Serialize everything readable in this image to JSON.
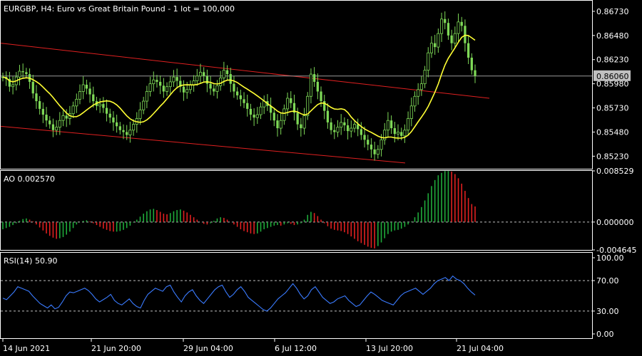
{
  "window": {
    "title": "EURGBP, H4:  Euro vs Great Britain Pound - 1 lot = 100,000"
  },
  "chart_data": [
    {
      "type": "candlestick",
      "symbol": "EURGBP",
      "timeframe": "H4",
      "title": "EURGBP, H4:  Euro vs Great Britain Pound - 1 lot = 100,000",
      "ylim": [
        0.851,
        0.8684
      ],
      "y_ticks": [
        "0.86730",
        "0.86480",
        "0.86230",
        "0.85980",
        "0.85730",
        "0.85480",
        "0.85230"
      ],
      "y_tick_values": [
        0.8673,
        0.8648,
        0.8623,
        0.8598,
        0.8573,
        0.8548,
        0.8523
      ],
      "current_price": "0.86060",
      "current_price_value": 0.8606,
      "x_ticks": [
        "14 Jun 2021",
        "21 Jun 20:00",
        "29 Jun 04:00",
        "6 Jul 12:00",
        "13 Jul 20:00",
        "21 Jul 04:00"
      ],
      "close_series": [
        0.8605,
        0.8603,
        0.8595,
        0.8597,
        0.8605,
        0.8611,
        0.861,
        0.8608,
        0.86,
        0.8588,
        0.858,
        0.8572,
        0.8566,
        0.856,
        0.8556,
        0.855,
        0.8553,
        0.856,
        0.8565,
        0.8562,
        0.8567,
        0.8575,
        0.8582,
        0.859,
        0.8597,
        0.8593,
        0.8587,
        0.858,
        0.8575,
        0.8577,
        0.8573,
        0.8567,
        0.8563,
        0.8558,
        0.8554,
        0.855,
        0.8548,
        0.8545,
        0.855,
        0.8556,
        0.8562,
        0.8571,
        0.858,
        0.859,
        0.8598,
        0.8602,
        0.86,
        0.8596,
        0.859,
        0.8595,
        0.86,
        0.8605,
        0.8601,
        0.8595,
        0.8589,
        0.8592,
        0.8597,
        0.8601,
        0.8606,
        0.861,
        0.8606,
        0.8598,
        0.8593,
        0.859,
        0.8596,
        0.8604,
        0.8612,
        0.8608,
        0.8598,
        0.859,
        0.8586,
        0.8582,
        0.8578,
        0.8572,
        0.8566,
        0.8563,
        0.8566,
        0.8574,
        0.858,
        0.8575,
        0.8568,
        0.856,
        0.8552,
        0.856,
        0.8572,
        0.8583,
        0.8578,
        0.8568,
        0.8556,
        0.8552,
        0.8565,
        0.8585,
        0.8608,
        0.86,
        0.859,
        0.858,
        0.857,
        0.8558,
        0.855,
        0.8548,
        0.8553,
        0.8558,
        0.8555,
        0.8549,
        0.8552,
        0.8556,
        0.8551,
        0.8545,
        0.854,
        0.8535,
        0.853,
        0.8525,
        0.853,
        0.854,
        0.855,
        0.856,
        0.8552,
        0.8546,
        0.8548,
        0.8544,
        0.855,
        0.8562,
        0.8575,
        0.8585,
        0.8592,
        0.8598,
        0.8612,
        0.863,
        0.864,
        0.8636,
        0.865,
        0.8665,
        0.8661,
        0.8648,
        0.864,
        0.865,
        0.8662,
        0.8658,
        0.864,
        0.8625,
        0.8612,
        0.8606
      ]
    },
    {
      "type": "histogram",
      "indicator": "AO",
      "title": "AO 0.002570",
      "ylim": [
        -0.004645,
        0.008529
      ],
      "y_ticks": [
        "0.008529",
        "0.000000",
        "-0.004645"
      ],
      "y_tick_values": [
        0.008529,
        0.0,
        -0.004645
      ],
      "values": [
        -0.0012,
        -0.001,
        -0.0008,
        -0.0005,
        -0.0002,
        0.0002,
        0.0005,
        0.0006,
        0.0004,
        0.0001,
        -0.0004,
        -0.0009,
        -0.0014,
        -0.0019,
        -0.0023,
        -0.0026,
        -0.0028,
        -0.0027,
        -0.0025,
        -0.0021,
        -0.0016,
        -0.001,
        -0.0004,
        0.0,
        0.0002,
        0.0003,
        0.0001,
        -0.0002,
        -0.0005,
        -0.0008,
        -0.0011,
        -0.0013,
        -0.0015,
        -0.0016,
        -0.0016,
        -0.0015,
        -0.0013,
        -0.001,
        -0.0006,
        -0.0001,
        0.0004,
        0.0009,
        0.0014,
        0.0018,
        0.0021,
        0.0022,
        0.002,
        0.0017,
        0.0014,
        0.0013,
        0.0015,
        0.0018,
        0.002,
        0.0021,
        0.0019,
        0.0016,
        0.0012,
        0.0008,
        0.0004,
        0.0,
        -0.0003,
        -0.0004,
        -0.0002,
        0.0002,
        0.0006,
        0.0008,
        0.0007,
        0.0004,
        0.0,
        -0.0004,
        -0.0008,
        -0.0012,
        -0.0015,
        -0.0017,
        -0.0019,
        -0.002,
        -0.0019,
        -0.0016,
        -0.0012,
        -0.001,
        -0.0008,
        -0.0006,
        -0.0005,
        -0.0006,
        -0.0004,
        -0.0002,
        -0.0003,
        -0.0005,
        -0.0004,
        -0.0002,
        0.0004,
        0.0012,
        0.0017,
        0.0015,
        0.001,
        0.0004,
        -0.0002,
        -0.0007,
        -0.0011,
        -0.0013,
        -0.0014,
        -0.0015,
        -0.0017,
        -0.002,
        -0.0024,
        -0.0028,
        -0.0032,
        -0.0035,
        -0.0038,
        -0.0041,
        -0.0043,
        -0.0044,
        -0.004,
        -0.0034,
        -0.0027,
        -0.002,
        -0.0016,
        -0.0014,
        -0.0013,
        -0.0011,
        -0.0008,
        -0.0004,
        0.0001,
        0.0008,
        0.0016,
        0.0025,
        0.0036,
        0.0048,
        0.006,
        0.007,
        0.0078,
        0.0082,
        0.0085,
        0.0085,
        0.0084,
        0.008,
        0.0073,
        0.0064,
        0.0052,
        0.004,
        0.003,
        0.0026
      ]
    },
    {
      "type": "line",
      "indicator": "RSI(14)",
      "title": "RSI(14) 50.90",
      "ylim": [
        0,
        100
      ],
      "y_ticks": [
        "100.00",
        "70.00",
        "30.00",
        "0.00"
      ],
      "y_tick_values": [
        100,
        70,
        30,
        0
      ],
      "levels": [
        70,
        30
      ],
      "values": [
        47,
        45,
        50,
        55,
        62,
        60,
        58,
        56,
        50,
        45,
        40,
        37,
        34,
        38,
        33,
        35,
        42,
        50,
        55,
        54,
        56,
        58,
        60,
        57,
        52,
        46,
        42,
        45,
        48,
        52,
        44,
        40,
        38,
        42,
        46,
        40,
        36,
        34,
        44,
        52,
        56,
        60,
        58,
        56,
        62,
        64,
        55,
        48,
        42,
        50,
        55,
        58,
        50,
        44,
        40,
        46,
        52,
        58,
        62,
        64,
        55,
        48,
        52,
        58,
        62,
        56,
        48,
        44,
        40,
        36,
        32,
        30,
        34,
        40,
        46,
        50,
        54,
        60,
        66,
        60,
        52,
        46,
        50,
        58,
        62,
        55,
        48,
        44,
        40,
        42,
        46,
        48,
        50,
        44,
        40,
        36,
        38,
        44,
        50,
        55,
        52,
        48,
        44,
        42,
        40,
        38,
        44,
        50,
        54,
        56,
        58,
        60,
        56,
        52,
        56,
        60,
        66,
        70,
        72,
        74,
        70,
        76,
        72,
        70,
        66,
        60,
        55,
        51
      ]
    }
  ],
  "style": {
    "background": "#000000",
    "grid_text": "#ffffff",
    "bull_candle": "#7ed957",
    "bear_candle": "#7ed957",
    "ma_line": "#ffff33",
    "channel_line": "#e02020",
    "ao_up": "#1faa3a",
    "ao_down": "#e02020",
    "rsi_line": "#3a7bff",
    "level_line": "#bfbfbf",
    "price_label_bg": "#c0c0c0",
    "price_label_text": "#000000"
  }
}
